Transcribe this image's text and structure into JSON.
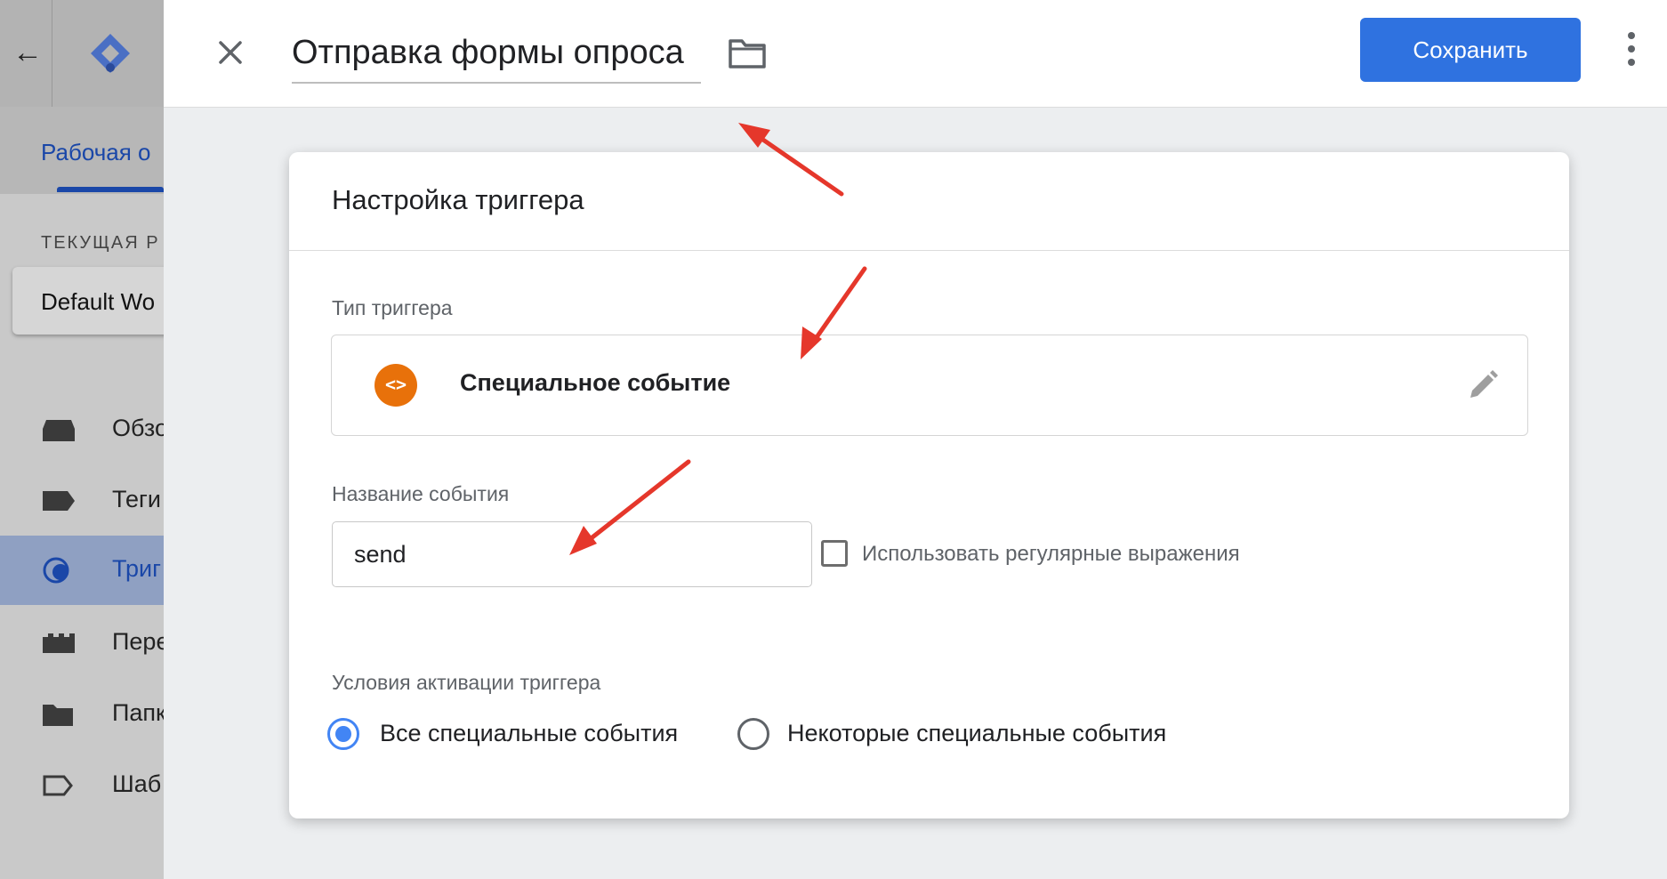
{
  "background": {
    "workspace_tab": "Рабочая о",
    "current_workspace_label": "ТЕКУЩАЯ Р",
    "workspace_name": "Default Wo",
    "nav_items": [
      {
        "label": "Обзо",
        "icon": "overview-icon",
        "active": false
      },
      {
        "label": "Теги",
        "icon": "tag-icon",
        "active": false
      },
      {
        "label": "Триг",
        "icon": "trigger-icon",
        "active": true
      },
      {
        "label": "Пере",
        "icon": "variables-icon",
        "active": false
      },
      {
        "label": "Папк",
        "icon": "folder-icon",
        "active": false
      },
      {
        "label": "Шаб",
        "icon": "template-icon",
        "active": false
      }
    ]
  },
  "header": {
    "title": "Отправка формы опроса",
    "save_label": "Сохранить",
    "close_icon": "close-icon",
    "folder_icon": "folder-icon",
    "more_icon": "more-vert-icon"
  },
  "card": {
    "title": "Настройка триггера",
    "trigger_type_label": "Тип триггера",
    "trigger_type_name": "Специальное событие",
    "trigger_type_icon": "custom-event-icon",
    "trigger_type_icon_glyph": "<>",
    "event_name_label": "Название события",
    "event_name_value": "send",
    "regex_label": "Использовать регулярные выражения",
    "regex_checked": false,
    "activation_label": "Условия активации триггера",
    "options": [
      {
        "label": "Все специальные события",
        "selected": true
      },
      {
        "label": "Некоторые специальные события",
        "selected": false
      }
    ]
  },
  "colors": {
    "accent": "#2f72e0",
    "trigger_icon_bg": "#e8710a",
    "annotation_arrow": "#e5372b"
  }
}
